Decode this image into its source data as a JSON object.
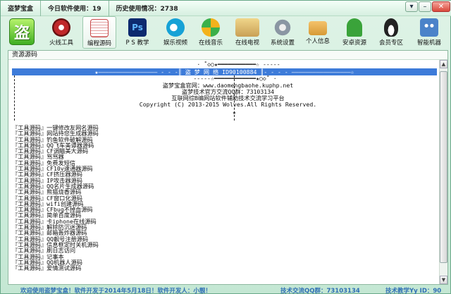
{
  "title": {
    "app": "盗梦宝盒",
    "today_label": "今日软件使用：19",
    "history_label": "历史使用情况：2738"
  },
  "toolbar": {
    "logo_glyph": "盗",
    "items": [
      {
        "label": "火线工具",
        "icon": "crossfire-icon",
        "color": "#c0282a"
      },
      {
        "label": "编程源码",
        "icon": "source-code-icon",
        "color": "#c84949"
      },
      {
        "label": "P S 教学",
        "icon": "photoshop-icon",
        "color": "#0d2a6f"
      },
      {
        "label": "娱乐视频",
        "icon": "video-icon",
        "color": "#16a2d6"
      },
      {
        "label": "在线音乐",
        "icon": "music-icon",
        "color": "#f3b21b"
      },
      {
        "label": "在线电视",
        "icon": "tv-icon",
        "color": "#e0b868"
      },
      {
        "label": "系统设置",
        "icon": "gear-icon",
        "color": "#8a96a3"
      },
      {
        "label": "个人信息",
        "icon": "folder-icon",
        "color": "#d79a36"
      },
      {
        "label": "安卓资源",
        "icon": "android-icon",
        "color": "#3aa33a"
      },
      {
        "label": "会员专区",
        "icon": "qq-penguin-icon",
        "color": "#222"
      },
      {
        "label": "智能机器",
        "icon": "robot-icon",
        "color": "#4b83c9"
      }
    ]
  },
  "panel": {
    "header": "资源源码",
    "banner": {
      "top_line": "· ˚◇○★━━━━━━━━━━━☆ -----",
      "selected_line": "★‒‒‒‒‒‒‒‒‒‒‒‒‒‒‒‒‒ - - -║ 盗 梦 网 络 ID90100884 ║- - - - ‒‒‒‒‒‒‒‒‒‒‒‒‒‒‒‒‒☆",
      "second_line": "-----☆━━━━━━━━━━━━★○◇˚ ·",
      "lines": [
        "盗梦宝盒官网：www.daomengbaohe.kuphp.net",
        "盗梦技术官方交流QQ群：73103134",
        "互联网综B编网站软件辅助技术交流学习平台",
        "Copyright (C) 2013-2015 Wolves.All Rights Reserved."
      ],
      "bottom_line": "★"
    },
    "items": [
      "『工具源码』一键修改友网名源码",
      "『工具源码』网站持您生成器源码",
      "『工具源码』钓鱼软件破解源码",
      "『工具源码』QQ飞车美谭器源码",
      "『工具源码』CF调瞄美大源码",
      "『工具源码』骂骂器",
      "『工具源码』免费发短信",
      "『工具源码』CF10v速通器源码",
      "『工具源码』CF挤压器源码",
      "『工具源码』IP攻击器源码",
      "『工具源码』QQ名片生成器源码",
      "『工具源码』熊猫烧香源码",
      "『工具源码』CF窗口化源码",
      "『工具源码』wifi创建源码",
      "『工具源码』CFbug不掉血源码",
      "『工具源码』简单百度源码",
      "『工具源码』卡iphone在线源码",
      "『工具源码』解除防沉迷源码",
      "『工具源码』邮箱轰炸器源码",
      "『工具源码』QQ靓号注册源码",
      "『工具源码』信息框定时关机源码",
      "『工具源码』刷日志访问",
      "『工具源码』记事本",
      "『工具源码』QQ机器人源码",
      "『工具源码』爱情测试源码"
    ]
  },
  "status": {
    "welcome": "欢迎使用盗梦宝盒！软件开发于2014年5月18日！软件开发人：小靓！",
    "qq_group": "技术交流QQ群：73103134",
    "yy": "技术教学Yy ID：90"
  }
}
